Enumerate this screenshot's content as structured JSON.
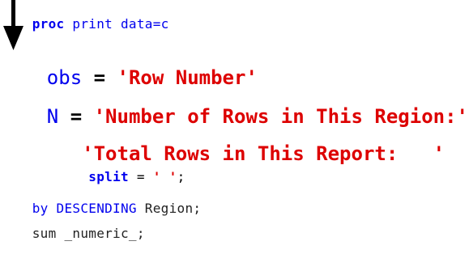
{
  "code": {
    "line1": {
      "kw": "proc",
      "rest": " print data=c"
    },
    "line2": {
      "var": "obs",
      "eq": " = ",
      "str": "'Row Number'"
    },
    "line3": {
      "var": "N",
      "eq": " = ",
      "str": "'Number of Rows in This Region:'"
    },
    "line4": {
      "indent": "   ",
      "str": "'Total Rows in This Report:   '"
    },
    "line5": {
      "indent": "       ",
      "kw": "split",
      "eq": " = ",
      "str": "' '",
      "end": ";"
    },
    "line6": {
      "kw": "by DESCENDING",
      "rest": " Region;"
    },
    "line7": {
      "text": "sum _numeric_;"
    }
  },
  "arrow": {
    "icon": "down-arrow-icon",
    "color": "#000000"
  }
}
